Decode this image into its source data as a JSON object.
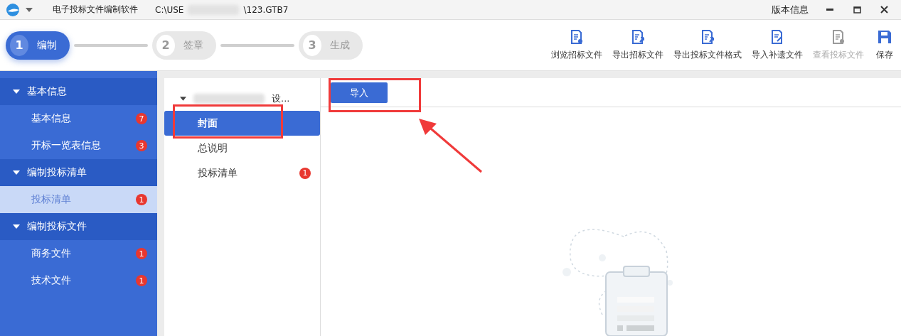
{
  "titlebar": {
    "app_name": "电子投标文件编制软件",
    "path_start": "C:\\USE",
    "path_end": "\\123.GTB7",
    "version_link": "版本信息"
  },
  "steps": [
    {
      "number": "1",
      "label": "编制",
      "selected": true
    },
    {
      "number": "2",
      "label": "签章",
      "selected": false
    },
    {
      "number": "3",
      "label": "生成",
      "selected": false
    }
  ],
  "toolbar": [
    {
      "label": "浏览招标文件",
      "kind": "view",
      "disabled": false
    },
    {
      "label": "导出招标文件",
      "kind": "export",
      "disabled": false
    },
    {
      "label": "导出投标文件格式",
      "kind": "export",
      "disabled": false
    },
    {
      "label": "导入补遗文件",
      "kind": "import",
      "disabled": false
    },
    {
      "label": "查看投标文件",
      "kind": "view",
      "disabled": true
    },
    {
      "label": "保存",
      "kind": "save",
      "disabled": false
    }
  ],
  "sidebar": [
    {
      "label": "基本信息",
      "expanded": true,
      "children": [
        {
          "label": "基本信息",
          "badge": "7",
          "selected": false
        },
        {
          "label": "开标一览表信息",
          "badge": "3",
          "selected": false
        }
      ]
    },
    {
      "label": "编制投标清单",
      "expanded": true,
      "children": [
        {
          "label": "投标清单",
          "badge": "1",
          "selected": true
        }
      ]
    },
    {
      "label": "编制投标文件",
      "expanded": true,
      "children": [
        {
          "label": "商务文件",
          "badge": "1",
          "selected": false
        },
        {
          "label": "技术文件",
          "badge": "1",
          "selected": false
        }
      ]
    }
  ],
  "tree": {
    "root_label": "设...",
    "expanded": true,
    "children": [
      {
        "label": "封面",
        "selected": true
      },
      {
        "label": "总说明",
        "selected": false
      },
      {
        "label": "投标清单",
        "selected": false,
        "badge": "1"
      }
    ]
  },
  "import_button": "导入"
}
